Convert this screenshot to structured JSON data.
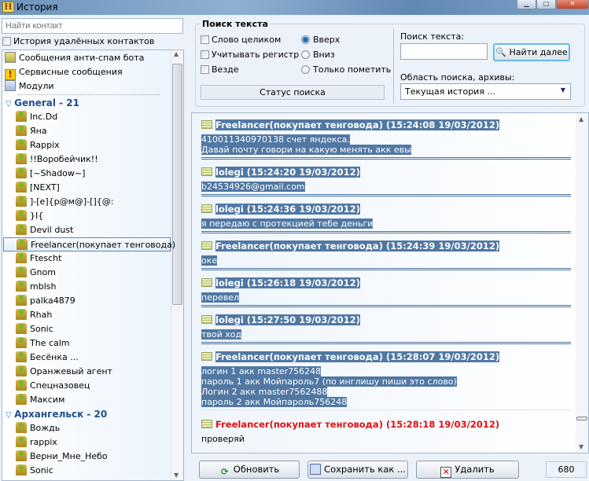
{
  "window": {
    "title": "История",
    "app_icon_letter": "H"
  },
  "left": {
    "search_placeholder": "Найти контакт",
    "deleted_history_label": "История удалённых контактов",
    "special_items": [
      {
        "label": "Сообщения анти-спам бота",
        "icon": "antispam-bot-icon"
      },
      {
        "label": "Сервисные сообщения",
        "icon": "warning-icon"
      },
      {
        "label": "Модули",
        "icon": "modules-icon"
      }
    ],
    "groups": [
      {
        "label": "General - 21",
        "contacts": [
          "Inc.Dd",
          "Яна",
          "Rappix",
          "!!Воробейчик!!",
          "[~Shadow~]",
          "[NEXT]",
          "]-[e]{p@м@]-[]{@:",
          "}I{",
          "Devil dust",
          "Freelancer(покупает тенговода)",
          "Ftescht",
          "Gnom",
          "mblsh",
          "palka4879",
          "Rhah",
          "Sonic",
          "The calm",
          "Бесёнка ...",
          "Оранжевый агент",
          "Спецназовец",
          "Максим"
        ]
      },
      {
        "label": "Архангельск - 20",
        "contacts": [
          "Вождь",
          "rappix",
          "Верни_Мне_Небо",
          "Sonic"
        ]
      }
    ],
    "selected_contact": "Freelancer(покупает тенговода)"
  },
  "search": {
    "group_title": "Поиск текста",
    "options": [
      {
        "label": "Слово целиком",
        "checked": false
      },
      {
        "label": "Учитывать регистр",
        "checked": false
      },
      {
        "label": "Везде",
        "checked": false
      }
    ],
    "direction": [
      {
        "label": "Вверх",
        "selected": true
      },
      {
        "label": "Вниз",
        "selected": false
      },
      {
        "label": "Только пометить",
        "selected": false
      }
    ],
    "status_label": "Статус поиска",
    "text_label": "Поиск текста:",
    "text_value": "",
    "find_next": "Найти далее",
    "scope_label": "Область поиска, архивы:",
    "scope_value": "Текущая история ..."
  },
  "messages": [
    {
      "header": "Freelancer(покупает тенговода) (15:24:08 19/03/2012)",
      "lines": [
        "410011340970138 счет яндекса.",
        "Давай почту говори на какую менять акк евы"
      ],
      "highlighted": true
    },
    {
      "header": "lolegi (15:24:20 19/03/2012)",
      "lines": [
        "b24534926@gmail.com"
      ],
      "highlighted": true
    },
    {
      "header": "lolegi (15:24:36 19/03/2012)",
      "lines": [
        "я передаю с протекцией тебе деньги"
      ],
      "highlighted": true
    },
    {
      "header": "Freelancer(покупает тенговода) (15:24:39 19/03/2012)",
      "lines": [
        "оке"
      ],
      "highlighted": true
    },
    {
      "header": "lolegi (15:26:18 19/03/2012)",
      "lines": [
        "перевел"
      ],
      "highlighted": true
    },
    {
      "header": "lolegi (15:27:50 19/03/2012)",
      "lines": [
        "твой ход"
      ],
      "highlighted": true
    },
    {
      "header": "Freelancer(покупает тенговода) (15:28:07 19/03/2012)",
      "lines": [
        "логин 1 акк master756248",
        "пароль 1 акк Мойпароль7  (по инглишу пиши это слово)",
        "Логин 2 акк master7562488",
        "пароль 2 акк Мойпароль756248"
      ],
      "highlighted": true
    },
    {
      "header": "Freelancer(покупает тенговода) (15:28:18 19/03/2012)",
      "lines": [
        "проверяй"
      ],
      "highlighted": false,
      "header_color": "#e01010"
    }
  ],
  "buttons": {
    "refresh": "Обновить",
    "save_as": "Сохранить как ...",
    "delete": "Удалить"
  },
  "count": "680",
  "colors": {
    "highlight": "#5178a3",
    "group_text": "#1f4e8c",
    "new_message": "#e01010"
  }
}
